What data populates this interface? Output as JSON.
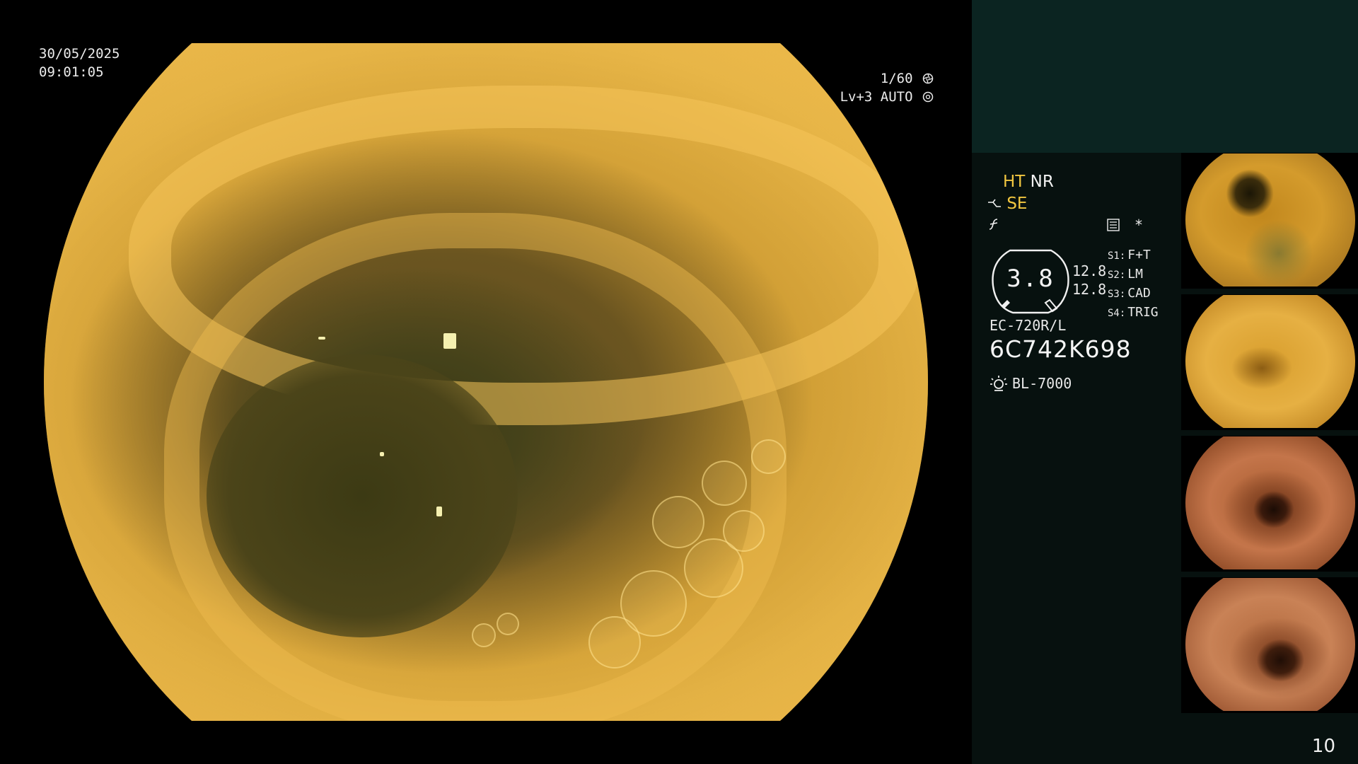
{
  "session": {
    "date": "30/05/2025",
    "time": "09:01:05"
  },
  "exposure": {
    "shutter": "1/60",
    "level": "Lv+3",
    "mode": "AUTO",
    "shutter_icon": "shutter-icon",
    "auto_icon": "auto-iris-icon"
  },
  "image_mode": {
    "ht_label": "HT",
    "nr_label": "NR",
    "se_label": "SE",
    "se_icon": "structure-enhancement-icon",
    "color_icon": "color-enhancement-icon",
    "colors": {
      "highlight": "#f2c740",
      "normal": "#f2f2f2"
    }
  },
  "status_icons": {
    "video_icon": "recording-icon",
    "star": "*"
  },
  "gauge": {
    "value": "3.8",
    "reading_1": "12.8",
    "reading_2": "12.8"
  },
  "switches": [
    {
      "key": "S1:",
      "value": "F+T"
    },
    {
      "key": "S2:",
      "value": "LM"
    },
    {
      "key": "S3:",
      "value": "CAD"
    },
    {
      "key": "S4:",
      "value": "TRIG"
    }
  ],
  "scope": {
    "model": "EC-720R/L",
    "serial": "6C742K698",
    "light_source": "BL-7000",
    "light_icon": "lamp-icon"
  },
  "frame_number": "10",
  "thumbnails": [
    {
      "name": "thumb-1",
      "tone": "yellow"
    },
    {
      "name": "thumb-2",
      "tone": "yellow"
    },
    {
      "name": "thumb-3",
      "tone": "red"
    },
    {
      "name": "thumb-4",
      "tone": "red"
    }
  ]
}
